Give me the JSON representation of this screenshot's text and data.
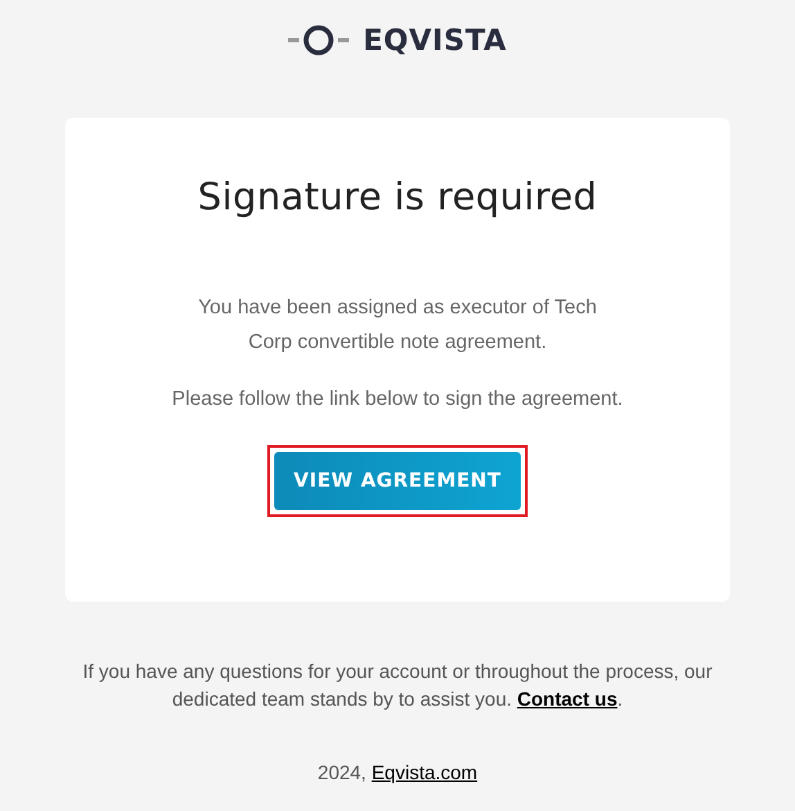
{
  "logo": {
    "text": "EQVISTA"
  },
  "card": {
    "title": "Signature is required",
    "paragraphs": [
      "You have been assigned as executor of Tech Corp convertible note agreement.",
      "Please follow the link below to sign the agreement."
    ],
    "button": {
      "label": "VIEW AGREEMENT",
      "highlighted": true
    }
  },
  "footer": {
    "text": "If you have any questions for your account or throughout the process, our dedicated team stands by to assist you. ",
    "link": "Contact us",
    "after": ".",
    "year": "2024, ",
    "site_link": "Eqvista.com"
  }
}
